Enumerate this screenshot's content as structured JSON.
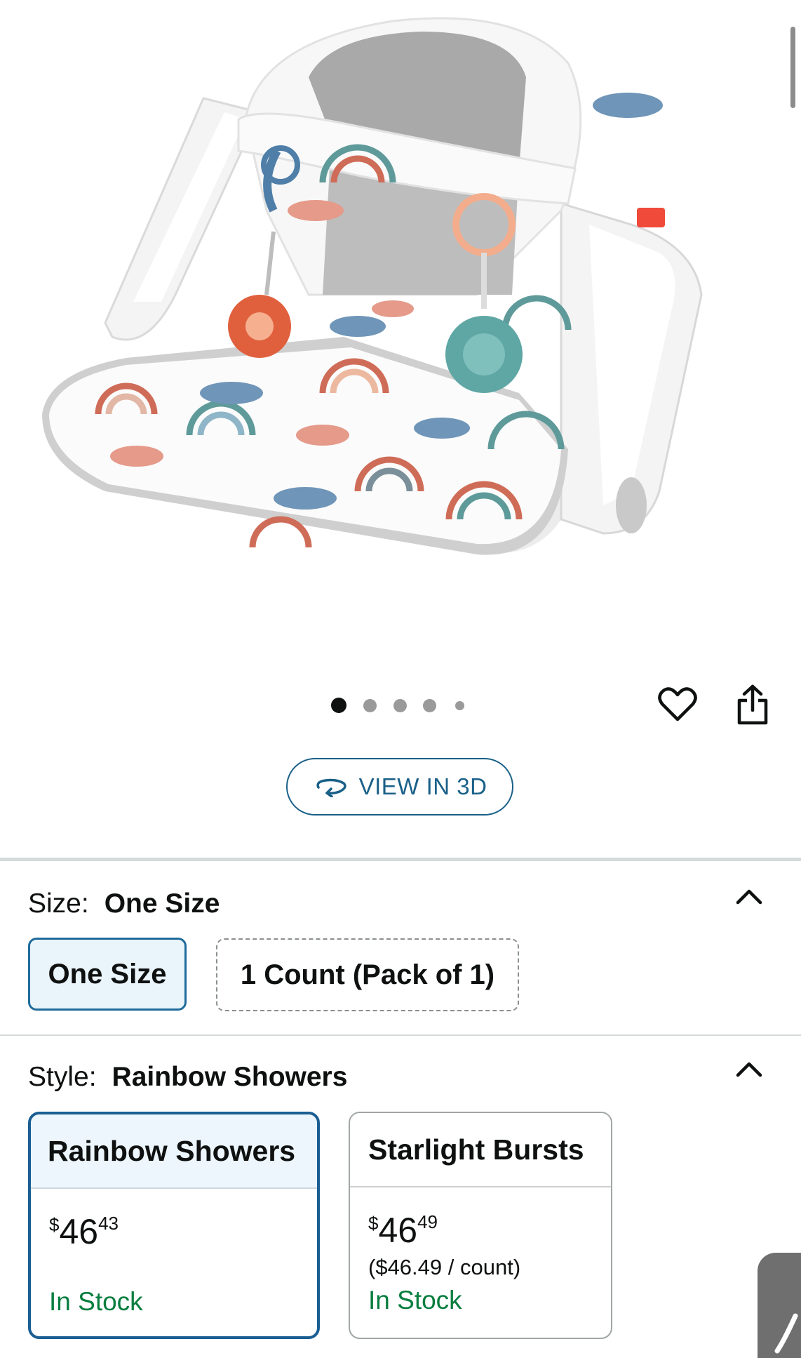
{
  "gallery": {
    "dots_total": 5,
    "active_dot": 1
  },
  "actions": {
    "favorite_icon": "heart-icon",
    "share_icon": "share-icon"
  },
  "view3d": {
    "label": "VIEW IN 3D",
    "icon": "rotate-3d-icon"
  },
  "size": {
    "label": "Size:",
    "selected": "One Size",
    "options": [
      "One Size",
      "1 Count (Pack of 1)"
    ]
  },
  "style": {
    "label": "Style:",
    "selected": "Rainbow Showers",
    "options": [
      {
        "name": "Rainbow Showers",
        "price_symbol": "$",
        "price_whole": "46",
        "price_fraction": "43",
        "unit_price": "",
        "stock": "In Stock"
      },
      {
        "name": "Starlight Bursts",
        "price_symbol": "$",
        "price_whole": "46",
        "price_fraction": "49",
        "unit_price": "($46.49 / count)",
        "stock": "In Stock"
      }
    ]
  },
  "colors": {
    "link_blue": "#1a6088",
    "selected_border": "#1a5e93",
    "in_stock_green": "#067d3e"
  }
}
